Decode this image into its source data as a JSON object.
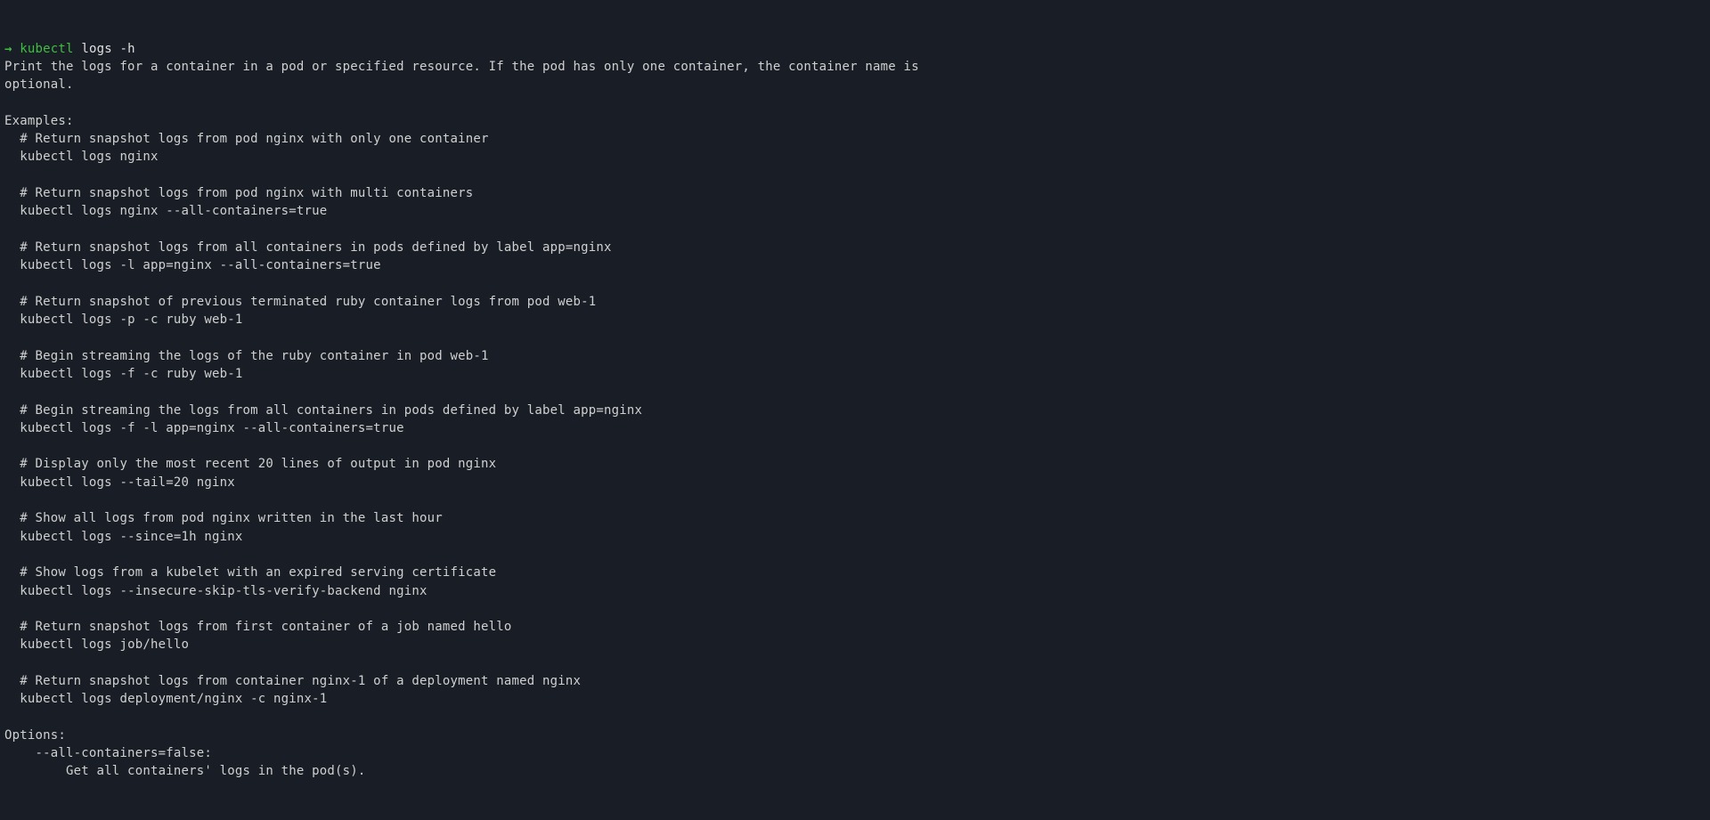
{
  "prompt": {
    "arrow": "→",
    "command": "kubectl",
    "args": "logs -h"
  },
  "description": "Print the logs for a container in a pod or specified resource. If the pod has only one container, the container name is\noptional.",
  "examples_header": "Examples:",
  "examples": [
    {
      "comment": "# Return snapshot logs from pod nginx with only one container",
      "cmd": "kubectl logs nginx"
    },
    {
      "comment": "# Return snapshot logs from pod nginx with multi containers",
      "cmd": "kubectl logs nginx --all-containers=true"
    },
    {
      "comment": "# Return snapshot logs from all containers in pods defined by label app=nginx",
      "cmd": "kubectl logs -l app=nginx --all-containers=true"
    },
    {
      "comment": "# Return snapshot of previous terminated ruby container logs from pod web-1",
      "cmd": "kubectl logs -p -c ruby web-1"
    },
    {
      "comment": "# Begin streaming the logs of the ruby container in pod web-1",
      "cmd": "kubectl logs -f -c ruby web-1"
    },
    {
      "comment": "# Begin streaming the logs from all containers in pods defined by label app=nginx",
      "cmd": "kubectl logs -f -l app=nginx --all-containers=true"
    },
    {
      "comment": "# Display only the most recent 20 lines of output in pod nginx",
      "cmd": "kubectl logs --tail=20 nginx"
    },
    {
      "comment": "# Show all logs from pod nginx written in the last hour",
      "cmd": "kubectl logs --since=1h nginx"
    },
    {
      "comment": "# Show logs from a kubelet with an expired serving certificate",
      "cmd": "kubectl logs --insecure-skip-tls-verify-backend nginx"
    },
    {
      "comment": "# Return snapshot logs from first container of a job named hello",
      "cmd": "kubectl logs job/hello"
    },
    {
      "comment": "# Return snapshot logs from container nginx-1 of a deployment named nginx",
      "cmd": "kubectl logs deployment/nginx -c nginx-1"
    }
  ],
  "options_header": "Options:",
  "options": [
    {
      "flag": "--all-containers=false:",
      "desc": "Get all containers' logs in the pod(s)."
    }
  ]
}
